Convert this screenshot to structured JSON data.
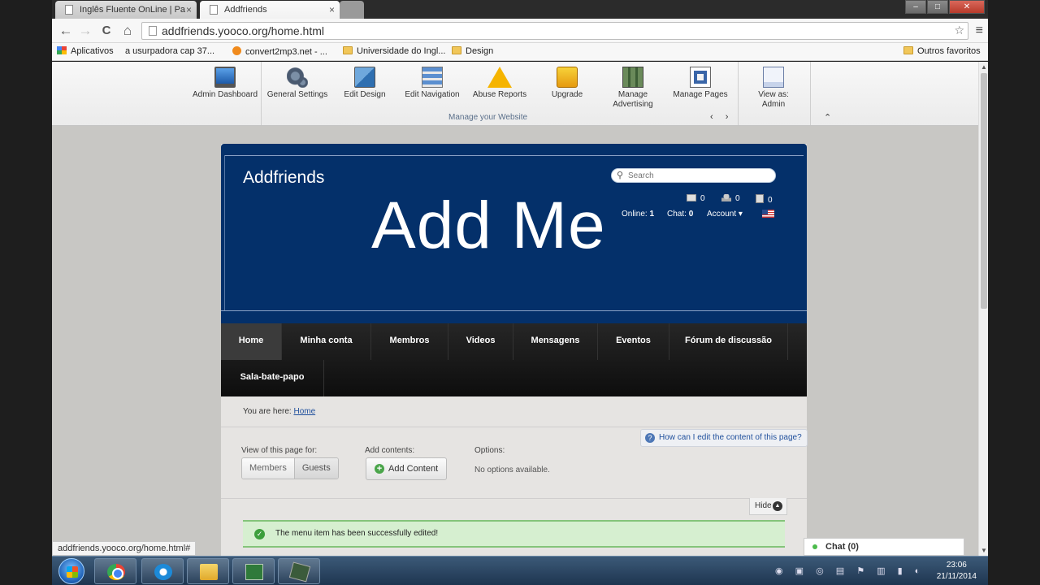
{
  "browser": {
    "tabs": [
      {
        "label": "Inglês Fluente OnLine | Pa",
        "close": "×"
      },
      {
        "label": "Addfriends",
        "close": "×"
      }
    ],
    "window_controls": {
      "minimize": "–",
      "maximize": "□",
      "close": "✕"
    },
    "url": "addfriends.yooco.org/home.html",
    "nav": {
      "back": "←",
      "forward": "→",
      "reload": "C",
      "home": "⌂"
    },
    "bookmarks": [
      {
        "label": "Aplicativos",
        "icon": "apps-grid-icon"
      },
      {
        "label": "a usurpadora cap 37...",
        "icon": "page-icon"
      },
      {
        "label": "convert2mp3.net - ...",
        "icon": "convert-icon"
      },
      {
        "label": "Universidade do Ingl...",
        "icon": "folder-icon"
      },
      {
        "label": "Design",
        "icon": "folder-icon"
      }
    ],
    "other_bookmarks": "Outros favoritos",
    "status_url": "addfriends.yooco.org/home.html#"
  },
  "admin_bar": {
    "items": [
      {
        "label": "Admin Dashboard",
        "icon": "monitor-icon"
      },
      {
        "label": "General Settings",
        "icon": "gears-icon"
      },
      {
        "label": "Edit Design",
        "icon": "design-icon"
      },
      {
        "label": "Edit Navigation",
        "icon": "navigation-icon"
      },
      {
        "label": "Abuse Reports",
        "icon": "warning-icon"
      },
      {
        "label": "Upgrade",
        "icon": "upgrade-icon"
      },
      {
        "label": "Manage Advertising",
        "icon": "advertising-icon"
      },
      {
        "label": "Manage Pages",
        "icon": "pages-icon"
      },
      {
        "label": "View as: Admin",
        "icon": "view-as-icon"
      }
    ],
    "manage_label": "Manage your Website",
    "arrows": "‹ ›",
    "collapse": "⌃"
  },
  "site": {
    "title": "Addfriends",
    "logo_text": "Add Me",
    "search_placeholder": "Search",
    "counters": {
      "messages": "0",
      "friend_requests": "0",
      "notifications": "0"
    },
    "online_label": "Online:",
    "online_value": "1",
    "chat_label": "Chat:",
    "chat_value": "0",
    "account_label": "Account ▾"
  },
  "nav_items": [
    "Home",
    "Minha conta",
    "Membros",
    "Videos",
    "Mensagens",
    "Eventos",
    "Fórum de discussão",
    "Sala-bate-papo"
  ],
  "breadcrumb": {
    "prefix": "You are here:",
    "link": "Home"
  },
  "help_link": "How can I edit the content of this page?",
  "options": {
    "view_label": "View of this page for:",
    "view_members": "Members",
    "view_guests": "Guests",
    "add_label": "Add contents:",
    "add_button": "Add Content",
    "options_label": "Options:",
    "no_options": "No options available."
  },
  "hide_button": "Hide",
  "success_message": "The menu item has been successfully edited!",
  "chat_bar": "Chat (0)",
  "taskbar": {
    "time": "23:06",
    "date": "21/11/2014"
  }
}
